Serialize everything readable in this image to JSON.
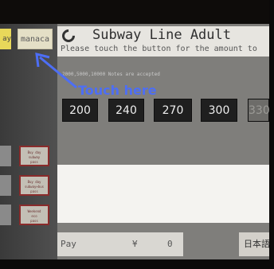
{
  "left_column": {
    "yellow_button_text": "ay",
    "manaca_button_text": "manaca",
    "side_buttons": [
      {
        "line1": "Buy day",
        "line2": "subway",
        "line3": "pass"
      },
      {
        "line1": "Buy day",
        "line2": "subway+bus",
        "line3": "pass"
      },
      {
        "line1": "Weekend",
        "line2": "eco",
        "line3": "pass"
      }
    ]
  },
  "header": {
    "title": "Subway Line Adult",
    "instruction": "Please touch the button for the amount to"
  },
  "notes_text": "2000,5000,10000 Notes are accepted",
  "fare_buttons": [
    "200",
    "240",
    "270",
    "300",
    "330"
  ],
  "pay": {
    "label": "Pay",
    "currency": "¥",
    "amount": "0"
  },
  "language_button": "日本語",
  "annotation": {
    "text": "Touch here",
    "color": "#4d6ef5"
  }
}
